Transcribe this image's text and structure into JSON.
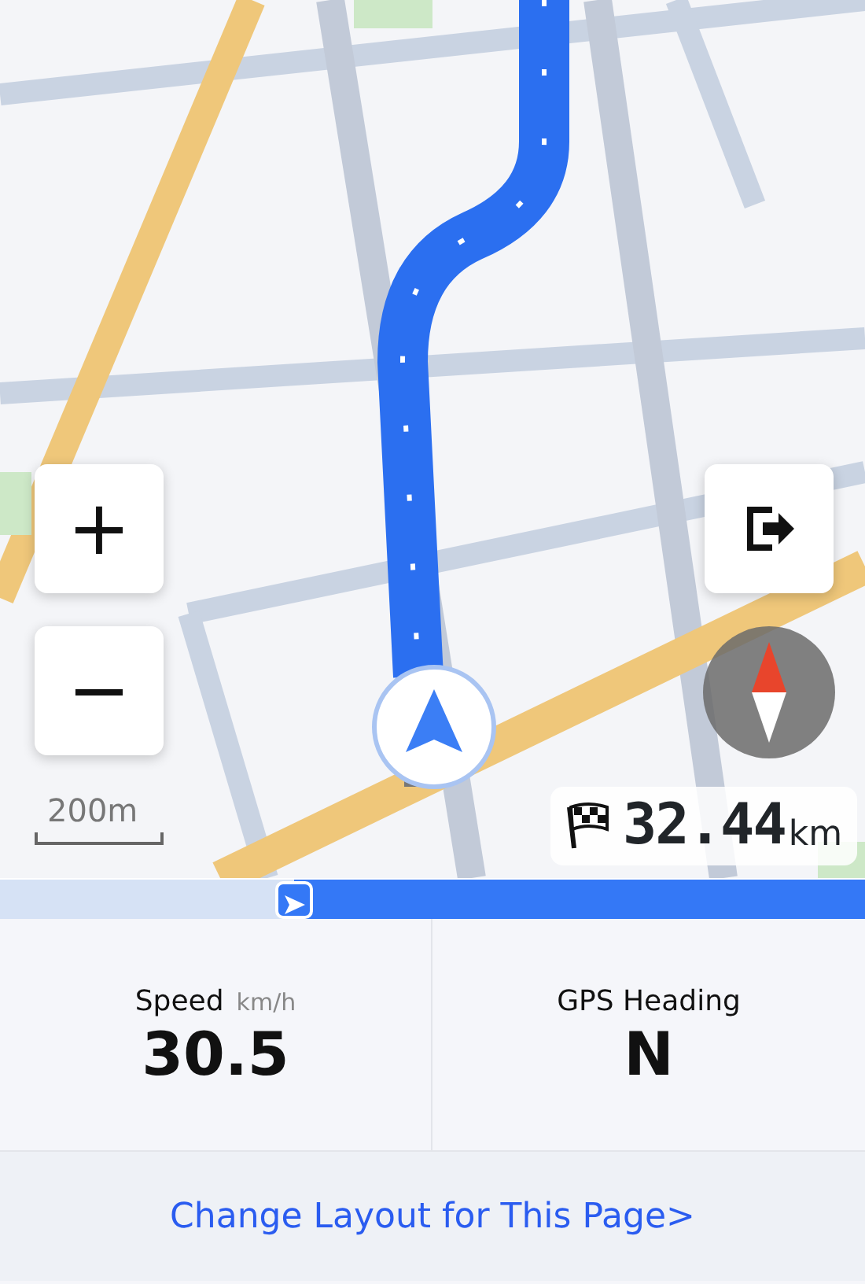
{
  "map": {
    "kind": "picture",
    "zoom_buttons": [
      "+",
      "−"
    ],
    "scale": "200m",
    "distance": {
      "value": "32.44",
      "unit": "km"
    }
  },
  "route_progress": {
    "level": 0.34
  },
  "stats": [
    {
      "label": "Speed",
      "unit": "km/h",
      "value": "30.5"
    },
    {
      "label": "GPS Heading",
      "value": "N"
    }
  ],
  "footer_link": "Change Layout for This Page>"
}
